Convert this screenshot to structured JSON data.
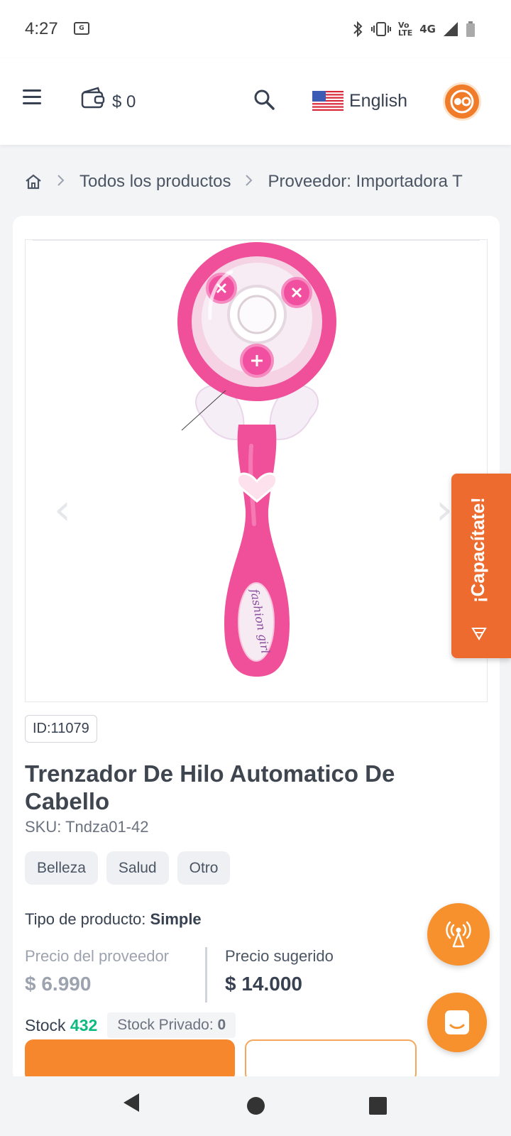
{
  "status_bar": {
    "time": "4:27",
    "volte_line1": "Vo",
    "volte_line2": "LTE",
    "network": "4G"
  },
  "header": {
    "wallet_amount": "$ 0",
    "language": "English"
  },
  "breadcrumb": {
    "items": [
      "Todos los productos",
      "Proveedor: Importadora T"
    ]
  },
  "product": {
    "id_label": "ID:11079",
    "title": "Trenzador De Hilo Automatico De Cabello",
    "sku": "SKU: Tndza01-42",
    "tags": [
      "Belleza",
      "Salud",
      "Otro"
    ],
    "type_label": "Tipo de producto:",
    "type_value": "Simple",
    "supplier_price_label": "Precio del proveedor",
    "supplier_price": "$ 6.990",
    "suggested_price_label": "Precio sugerido",
    "suggested_price": "$ 14.000",
    "stock_label": "Stock",
    "stock_value": "432",
    "private_stock_label": "Stock Privado:",
    "private_stock_value": "0",
    "image_text": "fashion girl"
  },
  "side_tab": {
    "label": "¡Capacítate!"
  },
  "colors": {
    "accent": "#f6872c",
    "side_tab": "#ee6b2f",
    "stock_green": "#10b981"
  },
  "icons": [
    "hamburger-icon",
    "wallet-icon",
    "search-icon",
    "us-flag-icon",
    "avatar-logo-icon",
    "home-icon",
    "chevron-right-icon",
    "broadcast-icon",
    "chat-icon"
  ]
}
